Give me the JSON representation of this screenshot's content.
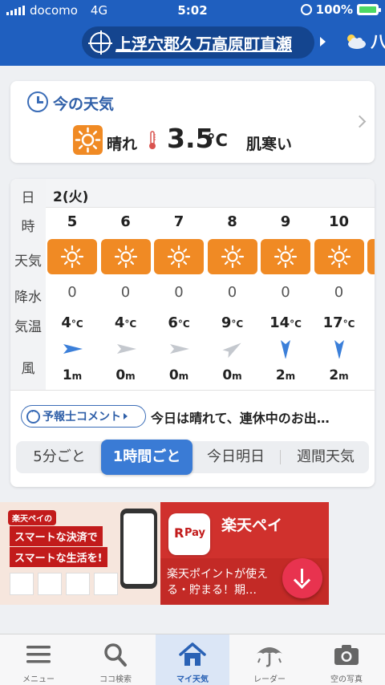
{
  "status_bar": {
    "carrier": "docomo",
    "network": "4G",
    "time": "5:02",
    "battery": "100%"
  },
  "header": {
    "location": "上浮穴郡久万高原町直瀬",
    "next_location_partial": "八"
  },
  "now": {
    "title": "今の天気",
    "condition": "晴れ",
    "temperature": "3.5",
    "unit": "°C",
    "feel": "肌寒い"
  },
  "hourly": {
    "labels": {
      "day": "日",
      "hour": "時",
      "weather": "天気",
      "rain": "降水",
      "temp": "気温",
      "wind": "風"
    },
    "date": "2(火)",
    "hours": [
      "5",
      "6",
      "7",
      "8",
      "9",
      "10"
    ],
    "rain": [
      "0",
      "0",
      "0",
      "0",
      "0",
      "0"
    ],
    "temps": [
      "4",
      "4",
      "6",
      "9",
      "14",
      "17"
    ],
    "temp_unit": "°C",
    "wind_speeds": [
      "1",
      "0",
      "0",
      "0",
      "2",
      "2"
    ],
    "wind_unit": "m",
    "wind_colors": [
      "#3b7fd9",
      "#c4c8ce",
      "#c4c8ce",
      "#c4c8ce",
      "#3b7fd9",
      "#3b7fd9"
    ]
  },
  "comment": {
    "label": "予報士コメント",
    "text": "今日は晴れて、連休中のお出…"
  },
  "segments": {
    "five_min": "5分ごと",
    "hourly": "1時間ごと",
    "today_tomorrow": "今日明日",
    "weekly": "週間天気"
  },
  "ad": {
    "tag": "楽天ペイの",
    "line1": "スマートな決済で",
    "line2": "スマートな生活を!",
    "brand": "楽天ペイ",
    "logo_r": "R",
    "logo_pay": "Pay",
    "description": "楽天ポイントが使える・貯まる！期…"
  },
  "tabs": {
    "menu": "メニュー",
    "search": "ココ検索",
    "my_weather": "マイ天気",
    "radar": "レーダー",
    "sky_photo": "空の写真"
  },
  "colors": {
    "header": "#1f5fbf",
    "sun_tile": "#f08a24",
    "accent": "#3a7bd5"
  }
}
